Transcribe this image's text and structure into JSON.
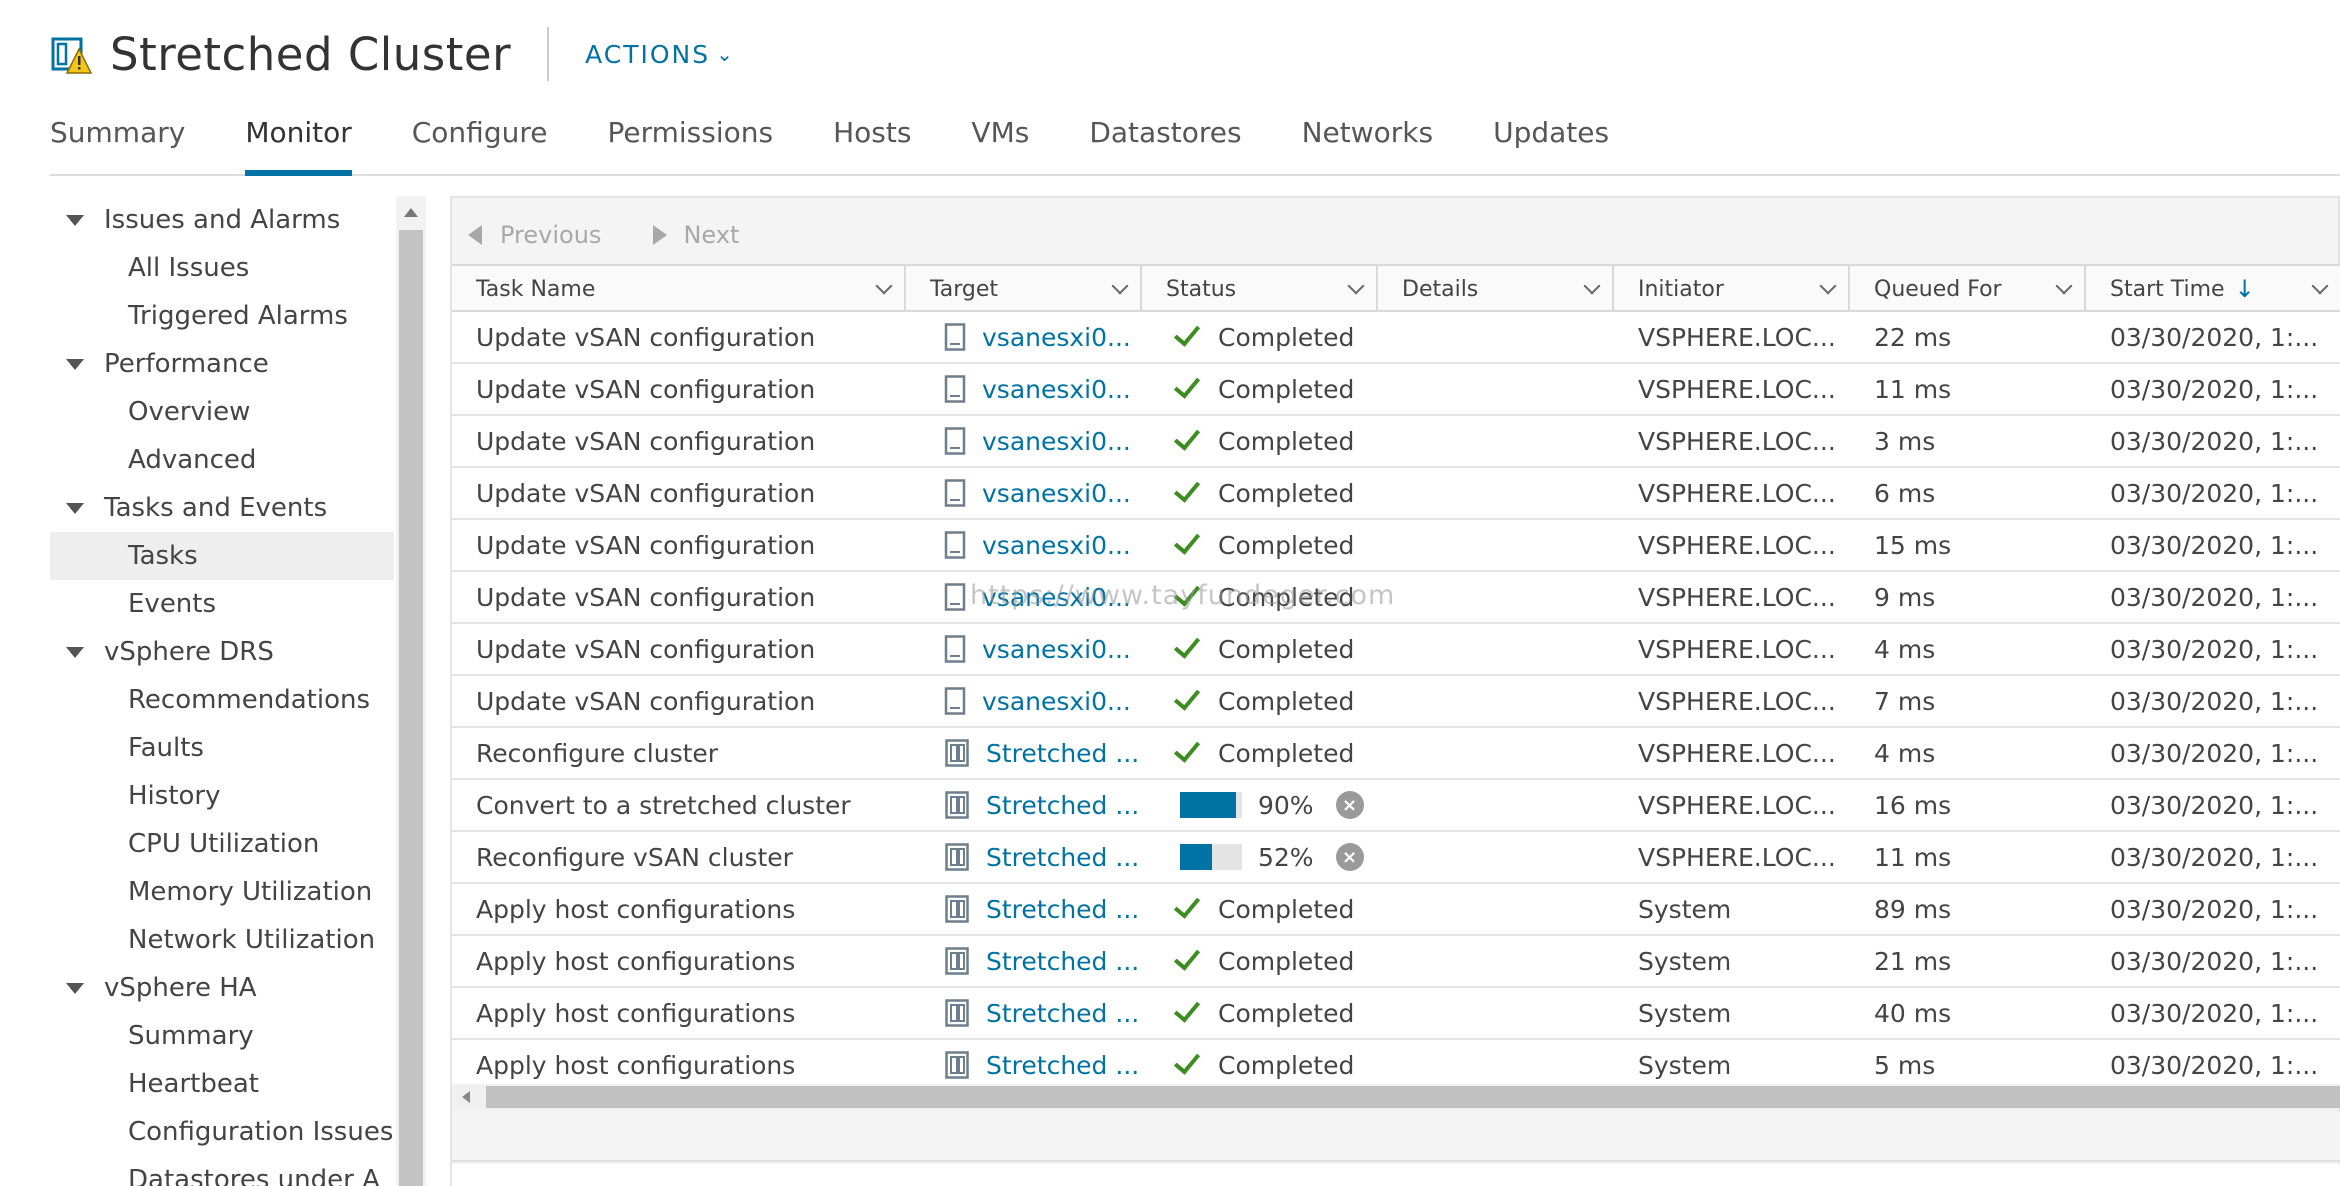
{
  "header": {
    "title": "Stretched Cluster",
    "actions_label": "ACTIONS",
    "icon": "cluster-warning-icon"
  },
  "tabs": [
    {
      "label": "Summary",
      "active": false
    },
    {
      "label": "Monitor",
      "active": true
    },
    {
      "label": "Configure",
      "active": false
    },
    {
      "label": "Permissions",
      "active": false
    },
    {
      "label": "Hosts",
      "active": false
    },
    {
      "label": "VMs",
      "active": false
    },
    {
      "label": "Datastores",
      "active": false
    },
    {
      "label": "Networks",
      "active": false
    },
    {
      "label": "Updates",
      "active": false
    }
  ],
  "nav": [
    {
      "label": "Issues and Alarms",
      "type": "group"
    },
    {
      "label": "All Issues",
      "type": "child"
    },
    {
      "label": "Triggered Alarms",
      "type": "child"
    },
    {
      "label": "Performance",
      "type": "group"
    },
    {
      "label": "Overview",
      "type": "child"
    },
    {
      "label": "Advanced",
      "type": "child"
    },
    {
      "label": "Tasks and Events",
      "type": "group"
    },
    {
      "label": "Tasks",
      "type": "child",
      "selected": true
    },
    {
      "label": "Events",
      "type": "child"
    },
    {
      "label": "vSphere DRS",
      "type": "group"
    },
    {
      "label": "Recommendations",
      "type": "child"
    },
    {
      "label": "Faults",
      "type": "child"
    },
    {
      "label": "History",
      "type": "child"
    },
    {
      "label": "CPU Utilization",
      "type": "child"
    },
    {
      "label": "Memory Utilization",
      "type": "child"
    },
    {
      "label": "Network Utilization",
      "type": "child"
    },
    {
      "label": "vSphere HA",
      "type": "group"
    },
    {
      "label": "Summary",
      "type": "child"
    },
    {
      "label": "Heartbeat",
      "type": "child"
    },
    {
      "label": "Configuration Issues",
      "type": "child"
    },
    {
      "label": "Datastores under A",
      "type": "child"
    }
  ],
  "pager": {
    "previous": "Previous",
    "next": "Next"
  },
  "grid": {
    "columns": [
      {
        "label": "Task Name"
      },
      {
        "label": "Target"
      },
      {
        "label": "Status"
      },
      {
        "label": "Details"
      },
      {
        "label": "Initiator"
      },
      {
        "label": "Queued For"
      },
      {
        "label": "Start Time",
        "sorted": "desc"
      }
    ],
    "rows": [
      {
        "task": "Update vSAN configuration",
        "target": "vsanesxi0...",
        "target_icon": "host-icon",
        "status": "Completed",
        "details": "",
        "initiator": "VSPHERE.LOC...",
        "queued": "22 ms",
        "start": "03/30/2020, 1:..."
      },
      {
        "task": "Update vSAN configuration",
        "target": "vsanesxi0...",
        "target_icon": "host-icon",
        "status": "Completed",
        "details": "",
        "initiator": "VSPHERE.LOC...",
        "queued": "11 ms",
        "start": "03/30/2020, 1:..."
      },
      {
        "task": "Update vSAN configuration",
        "target": "vsanesxi0...",
        "target_icon": "host-icon",
        "status": "Completed",
        "details": "",
        "initiator": "VSPHERE.LOC...",
        "queued": "3 ms",
        "start": "03/30/2020, 1:..."
      },
      {
        "task": "Update vSAN configuration",
        "target": "vsanesxi0...",
        "target_icon": "host-icon",
        "status": "Completed",
        "details": "",
        "initiator": "VSPHERE.LOC...",
        "queued": "6 ms",
        "start": "03/30/2020, 1:..."
      },
      {
        "task": "Update vSAN configuration",
        "target": "vsanesxi0...",
        "target_icon": "host-icon",
        "status": "Completed",
        "details": "",
        "initiator": "VSPHERE.LOC...",
        "queued": "15 ms",
        "start": "03/30/2020, 1:..."
      },
      {
        "task": "Update vSAN configuration",
        "target": "vsanesxi0...",
        "target_icon": "host-icon",
        "status": "Completed",
        "details": "",
        "initiator": "VSPHERE.LOC...",
        "queued": "9 ms",
        "start": "03/30/2020, 1:..."
      },
      {
        "task": "Update vSAN configuration",
        "target": "vsanesxi0...",
        "target_icon": "host-icon",
        "status": "Completed",
        "details": "",
        "initiator": "VSPHERE.LOC...",
        "queued": "4 ms",
        "start": "03/30/2020, 1:..."
      },
      {
        "task": "Update vSAN configuration",
        "target": "vsanesxi0...",
        "target_icon": "host-icon",
        "status": "Completed",
        "details": "",
        "initiator": "VSPHERE.LOC...",
        "queued": "7 ms",
        "start": "03/30/2020, 1:..."
      },
      {
        "task": "Reconfigure cluster",
        "target": "Stretched ...",
        "target_icon": "cluster-icon",
        "status": "Completed",
        "details": "",
        "initiator": "VSPHERE.LOC...",
        "queued": "4 ms",
        "start": "03/30/2020, 1:..."
      },
      {
        "task": "Convert to a stretched cluster",
        "target": "Stretched ...",
        "target_icon": "cluster-icon",
        "status": "90%",
        "progress": 0.9,
        "details": "",
        "initiator": "VSPHERE.LOC...",
        "queued": "16 ms",
        "start": "03/30/2020, 1:..."
      },
      {
        "task": "Reconfigure vSAN cluster",
        "target": "Stretched ...",
        "target_icon": "cluster-icon",
        "status": "52%",
        "progress": 0.52,
        "details": "",
        "initiator": "VSPHERE.LOC...",
        "queued": "11 ms",
        "start": "03/30/2020, 1:..."
      },
      {
        "task": "Apply host configurations",
        "target": "Stretched ...",
        "target_icon": "cluster-icon",
        "status": "Completed",
        "details": "",
        "initiator": "System",
        "queued": "89 ms",
        "start": "03/30/2020, 1:..."
      },
      {
        "task": "Apply host configurations",
        "target": "Stretched ...",
        "target_icon": "cluster-icon",
        "status": "Completed",
        "details": "",
        "initiator": "System",
        "queued": "21 ms",
        "start": "03/30/2020, 1:..."
      },
      {
        "task": "Apply host configurations",
        "target": "Stretched ...",
        "target_icon": "cluster-icon",
        "status": "Completed",
        "details": "",
        "initiator": "System",
        "queued": "40 ms",
        "start": "03/30/2020, 1:..."
      },
      {
        "task": "Apply host configurations",
        "target": "Stretched ...",
        "target_icon": "cluster-icon",
        "status": "Completed",
        "details": "",
        "initiator": "System",
        "queued": "5 ms",
        "start": "03/30/2020, 1:..."
      }
    ]
  },
  "watermark": "https://www.tayfundeger.com",
  "colors": {
    "accent": "#0072a3",
    "success": "#3c8d1f",
    "cancel": "#9a9a9a",
    "warning": "#f5c518"
  }
}
